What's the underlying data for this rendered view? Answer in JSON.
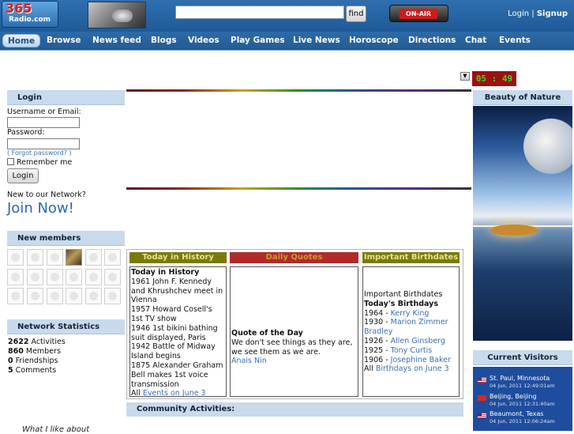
{
  "header": {
    "logo_number": "365",
    "logo_text": "Radio.com",
    "search_placeholder": "",
    "search_button": "find",
    "on_air_label": "ON-AIR",
    "login_link": "Login",
    "separator": "|",
    "signup_link": "Signup"
  },
  "nav": {
    "items": [
      "Home",
      "Browse",
      "News feed",
      "Blogs",
      "Videos",
      "Play Games",
      "Live News",
      "Horoscope",
      "Directions",
      "Chat",
      "Events"
    ]
  },
  "clock": {
    "arrow": "▼",
    "time": "05 : 49 ''"
  },
  "login": {
    "title": "Login",
    "username_label": "Username or Email:",
    "password_label": "Password:",
    "forgot": "( Forgot password? )",
    "remember": "Remember me",
    "button": "Login",
    "new_to_network": "New to our Network?",
    "join": "Join Now!"
  },
  "members": {
    "title": "New members"
  },
  "stats": {
    "title": "Network Statistics",
    "activities_count": "2622",
    "activities_label": "Activities",
    "members_count": "860",
    "members_label": "Members",
    "friendships_count": "0",
    "friendships_label": "Friendships",
    "comments_count": "5",
    "comments_label": "Comments"
  },
  "cut_text": "What I like about",
  "tabs": {
    "history_head": "Today in History",
    "quotes_head": "Daily Quotes",
    "birthdays_head": "Important Birthdates",
    "history": {
      "title": "Today in History",
      "events": [
        "1961 John F. Kennedy and Khrushchev meet in Vienna",
        "1957 Howard Cosell's 1st TV show",
        "1946 1st bikini bathing suit displayed, Paris",
        "1942 Battle of Midway Island begins",
        "1875 Alexander Graham Bell makes 1st voice transmission"
      ],
      "all_prefix": "All",
      "all_link": "Events on June 3"
    },
    "quote": {
      "title": "Quote of the Day",
      "text": "We don't see things as they are, we see them as we are.",
      "author": "Anais Nin"
    },
    "birthdays": {
      "intro": "Important Birthdates",
      "title": "Today's Birthdays",
      "people": [
        {
          "year": "1964",
          "name": "Kerry King"
        },
        {
          "year": "1930",
          "name": "Marion Zimmer Bradley"
        },
        {
          "year": "1926",
          "name": "Allen Ginsberg"
        },
        {
          "year": "1925",
          "name": "Tony Curtis"
        },
        {
          "year": "1906",
          "name": "Josephine Baker"
        }
      ],
      "all_prefix": "All",
      "all_link": "Birthdays on June 3"
    },
    "sep": " - "
  },
  "community": {
    "title": "Community Activities:"
  },
  "nature": {
    "title": "Beauty of Nature"
  },
  "visitors": {
    "title": "Current Visitors",
    "list": [
      {
        "place": "St. Paul, Minnesota",
        "time": "04 Jun, 2011 12:49:01am",
        "flag": "us-flag-icon"
      },
      {
        "place": "Beijing, Beijing",
        "time": "04 Jun, 2011 12:31:40am",
        "flag": "cn-flag-icon"
      },
      {
        "place": "Beaumont, Texas",
        "time": "04 Jun, 2011 12:06:24am",
        "flag": "us-flag-icon"
      }
    ]
  },
  "colors": {
    "header_blue": "#1f5a98",
    "section_head": "#c8daec",
    "history_tab": "#7a7a0c",
    "quotes_tab": "#b02a2a",
    "birthdays_tab": "#7a7a0c",
    "link": "#3c6fb1",
    "clock_bg": "#9c1111",
    "clock_fg": "#3bdb22"
  }
}
